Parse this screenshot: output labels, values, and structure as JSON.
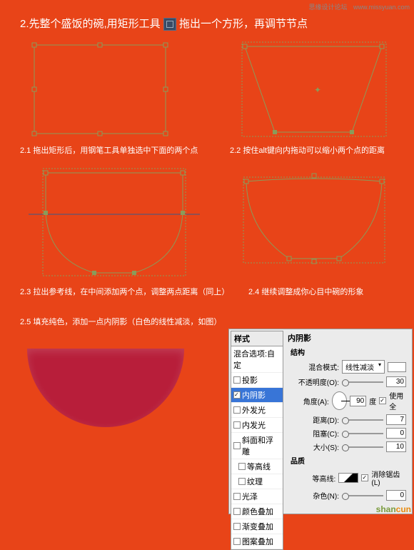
{
  "header": {
    "forum": "思缘设计论坛",
    "url": "www.missyuan.com"
  },
  "main_title_pre": "2.先整个盛饭的碗,用矩形工具",
  "main_title_post": "拖出一个方形，再调节节点",
  "steps": {
    "s21": "2.1 拖出矩形后，用钢笔工具单独选中下面的两个点",
    "s22": "2.2 按住alt键向内拖动可以缩小两个点的距离",
    "s23": "2.3 拉出参考线，在中间添加两个点，调整两点距离（同上）",
    "s24": "2.4 继续调整成你心目中碗的形象",
    "s25": "2.5 填充纯色，添加一点内阴影（白色的线性减淡，如图）"
  },
  "dialog": {
    "left_header": "样式",
    "items": [
      {
        "label": "混合选项:自定",
        "chk": false,
        "sel": false,
        "nobox": true
      },
      {
        "label": "投影",
        "chk": false,
        "sel": false
      },
      {
        "label": "内阴影",
        "chk": true,
        "sel": true
      },
      {
        "label": "外发光",
        "chk": false,
        "sel": false
      },
      {
        "label": "内发光",
        "chk": false,
        "sel": false
      },
      {
        "label": "斜面和浮雕",
        "chk": false,
        "sel": false
      },
      {
        "label": "等高线",
        "chk": false,
        "sel": false,
        "indent": true
      },
      {
        "label": "纹理",
        "chk": false,
        "sel": false,
        "indent": true
      },
      {
        "label": "光泽",
        "chk": false,
        "sel": false
      },
      {
        "label": "颜色叠加",
        "chk": false,
        "sel": false
      },
      {
        "label": "渐变叠加",
        "chk": false,
        "sel": false
      },
      {
        "label": "图案叠加",
        "chk": false,
        "sel": false
      }
    ],
    "right": {
      "title": "内阴影",
      "section1": "结构",
      "blend_label": "混合模式:",
      "blend_value": "线性减淡",
      "opacity_label": "不透明度(O):",
      "opacity_value": "30",
      "angle_label": "角度(A):",
      "angle_value": "90",
      "angle_unit": "度",
      "global_label": "使用全",
      "distance_label": "距离(D):",
      "distance_value": "7",
      "choke_label": "阻塞(C):",
      "choke_value": "0",
      "size_label": "大小(S):",
      "size_value": "10",
      "section2": "品质",
      "contour_label": "等高线:",
      "antialias_label": "消除锯齿(L)",
      "noise_label": "杂色(N):",
      "noise_value": "0"
    }
  },
  "watermark": {
    "text1": "shan",
    "text2": "cun"
  }
}
